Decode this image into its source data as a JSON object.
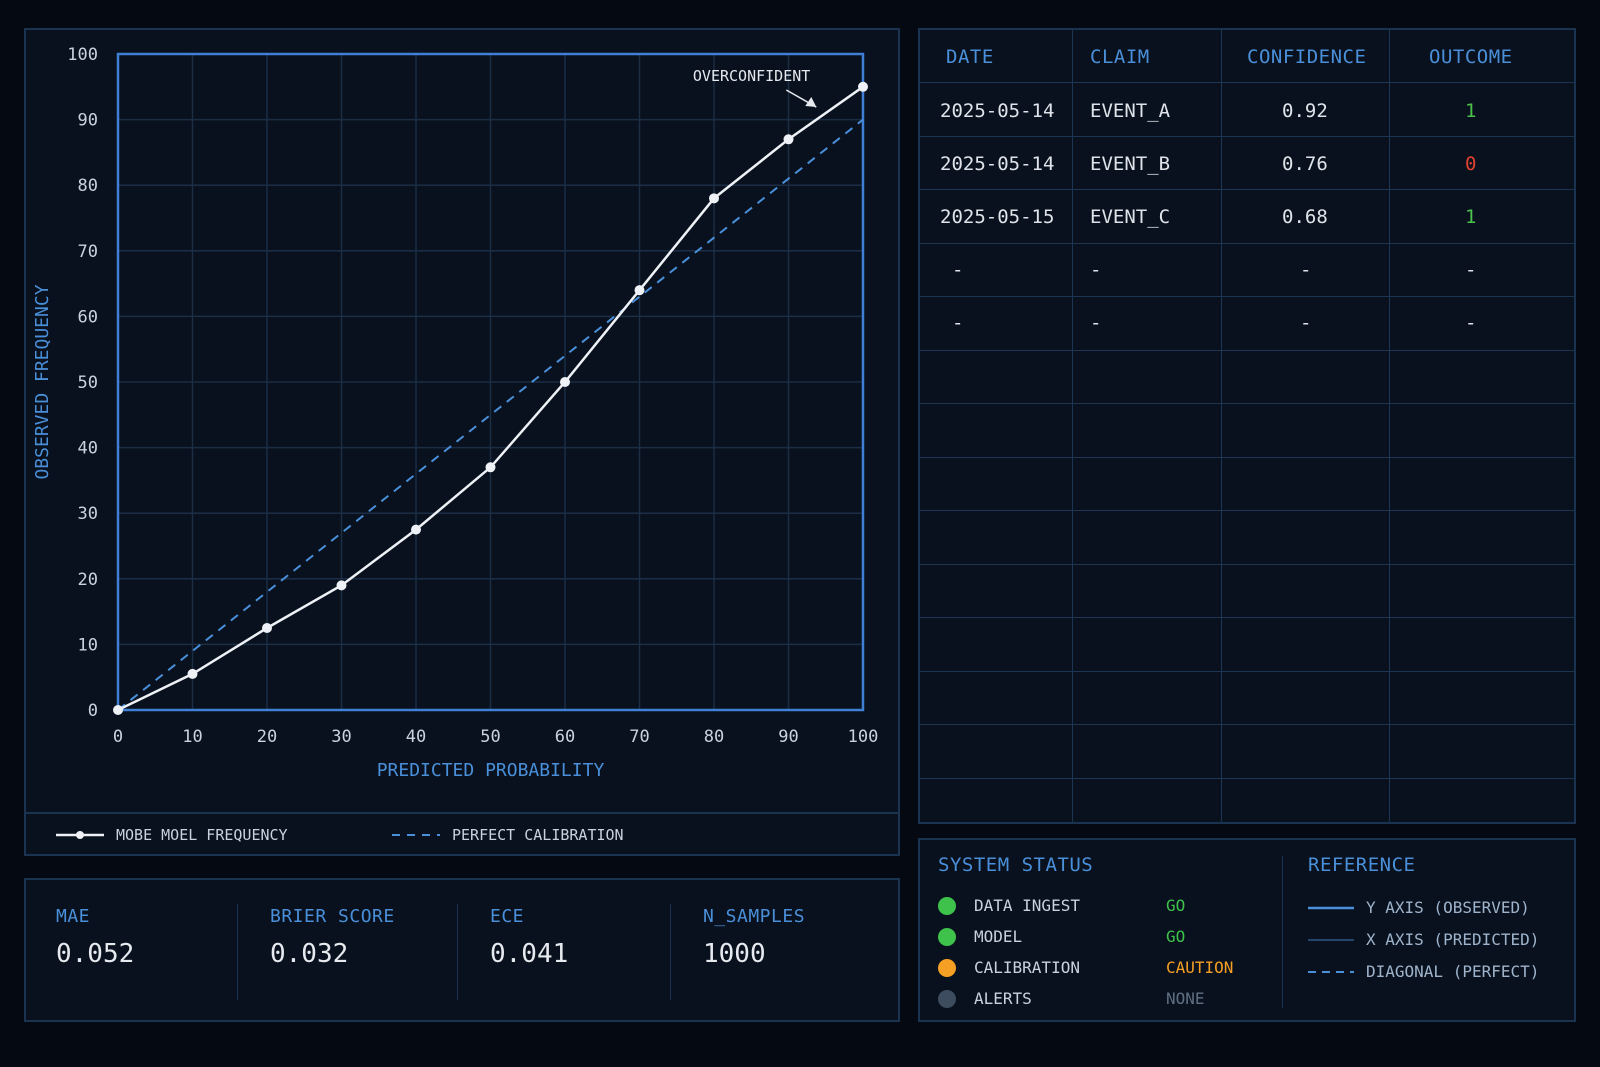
{
  "colors": {
    "accent_blue": "#4a8fd9",
    "plot_border": "#3f7fd6",
    "grid": "#1b2e45",
    "model_line": "#eef1f5",
    "go": "#3ec24c",
    "caution": "#f5a024",
    "none": "#3d4c5e",
    "outcome_positive": "#4cc24c",
    "outcome_negative": "#e0422e"
  },
  "chart_data": {
    "type": "line",
    "xlabel": "PREDICTED PROBABILITY",
    "ylabel": "OBSERVED FREQUENCY",
    "xlim": [
      0,
      100
    ],
    "ylim": [
      0,
      100
    ],
    "x_ticks": [
      "0",
      "10",
      "20",
      "30",
      "40",
      "50",
      "60",
      "70",
      "80",
      "90",
      "100"
    ],
    "y_ticks": [
      "0",
      "10",
      "20",
      "30",
      "40",
      "50",
      "60",
      "70",
      "80",
      "90",
      "100"
    ],
    "grid": true,
    "legend_position": "bottom",
    "annotation": {
      "text": "OVERCONFIDENT",
      "x": 94,
      "y": 91
    },
    "series": [
      {
        "name": "MOBE MOEL FREQUENCY",
        "style": "solid-markers",
        "x": [
          0,
          10,
          20,
          30,
          40,
          50,
          60,
          70,
          80,
          90,
          100
        ],
        "y": [
          0,
          5.5,
          12.5,
          19,
          27.5,
          37,
          50,
          64,
          78,
          87,
          95
        ]
      },
      {
        "name": "PERFECT CALIBRATION",
        "style": "dashed",
        "x": [
          0,
          100
        ],
        "y": [
          0,
          90
        ]
      }
    ]
  },
  "metrics": [
    {
      "label": "MAE",
      "value": "0.052"
    },
    {
      "label": "BRIER SCORE",
      "value": "0.032"
    },
    {
      "label": "ECE",
      "value": "0.041"
    },
    {
      "label": "N_SAMPLES",
      "value": "1000"
    }
  ],
  "table": {
    "headers": [
      "DATE",
      "CLAIM",
      "CONFIDENCE",
      "OUTCOME"
    ],
    "rows": [
      [
        "2025-05-14",
        "EVENT_A",
        "0.92",
        "1"
      ],
      [
        "2025-05-14",
        "EVENT_B",
        "0.76",
        "0"
      ],
      [
        "2025-05-15",
        "EVENT_C",
        "0.68",
        "1"
      ],
      [
        "-",
        "-",
        "-",
        "-"
      ],
      [
        "-",
        "-",
        "-",
        "-"
      ]
    ]
  },
  "system_status": {
    "title": "SYSTEM STATUS",
    "items": [
      {
        "label": "DATA INGEST",
        "value": "GO",
        "color": "#3ec24c"
      },
      {
        "label": "MODEL",
        "value": "GO",
        "color": "#3ec24c"
      },
      {
        "label": "CALIBRATION",
        "value": "CAUTION",
        "color": "#f5a024"
      },
      {
        "label": "ALERTS",
        "value": "NONE",
        "color": "#3d4c5e"
      }
    ]
  },
  "reference": {
    "title": "REFERENCE",
    "items": [
      {
        "label": "Y AXIS (OBSERVED)",
        "style": "solid"
      },
      {
        "label": "X AXIS (PREDICTED)",
        "style": "thin"
      },
      {
        "label": "DIAGONAL (PERFECT)",
        "style": "dashed"
      }
    ]
  }
}
